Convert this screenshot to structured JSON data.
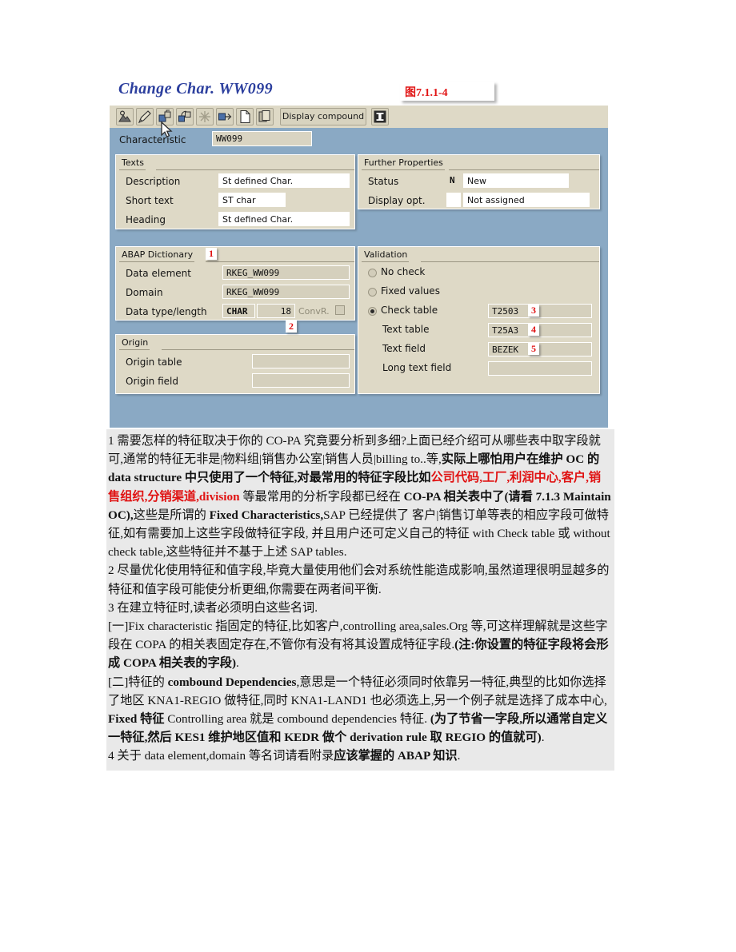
{
  "screenshot": {
    "window_title": "Change Char. WW099",
    "figure_label": "图7.1.1-4",
    "toolbar": {
      "icons": [
        {
          "name": "display-overview-icon",
          "glyph": "person-mountain"
        },
        {
          "name": "edit-pencil-icon",
          "glyph": "pencil"
        },
        {
          "name": "create-characteristic-icon",
          "glyph": "boxes-up"
        },
        {
          "name": "copy-characteristic-icon",
          "glyph": "boxes-link"
        },
        {
          "name": "delete-star-icon",
          "glyph": "asterisk"
        },
        {
          "name": "transport-icon",
          "glyph": "box-arrow"
        },
        {
          "name": "new-document-icon",
          "glyph": "page"
        },
        {
          "name": "copy-document-icon",
          "glyph": "pages"
        }
      ],
      "display_compound_label": "Display compound",
      "info_label": "i"
    },
    "characteristic": {
      "label": "Characteristic",
      "value": "WW099"
    },
    "texts_group": {
      "title": "Texts",
      "rows": [
        {
          "label": "Description",
          "value": "St defined Char."
        },
        {
          "label": "Short text",
          "value": "ST char"
        },
        {
          "label": "Heading",
          "value": "St defined Char."
        }
      ]
    },
    "further_properties_group": {
      "title": "Further Properties",
      "status": {
        "label": "Status",
        "code": "N",
        "value": "New"
      },
      "display_opt": {
        "label": "Display opt.",
        "code": "",
        "value": "Not assigned"
      }
    },
    "abap_dictionary_group": {
      "title": "ABAP Dictionary",
      "badge": "1",
      "rows": [
        {
          "label": "Data element",
          "value": "RKEG_WW099"
        },
        {
          "label": "Domain",
          "value": "RKEG_WW099"
        }
      ],
      "data_type": {
        "label": "Data type/length",
        "type": "CHAR",
        "length": "18",
        "conv_label": "ConvR.",
        "badge": "2"
      }
    },
    "origin_group": {
      "title": "Origin",
      "rows": [
        {
          "label": "Origin table",
          "value": ""
        },
        {
          "label": "Origin field",
          "value": ""
        }
      ]
    },
    "validation_group": {
      "title": "Validation",
      "options": [
        {
          "label": "No check",
          "selected": false
        },
        {
          "label": "Fixed values",
          "selected": false
        },
        {
          "label": "Check table",
          "selected": true
        }
      ],
      "check_table": {
        "value": "T2503",
        "badge": "3"
      },
      "text_table": {
        "label": "Text table",
        "value": "T25A3",
        "badge": "4"
      },
      "text_field": {
        "label": "Text field",
        "value": "BEZEK",
        "badge": "5"
      },
      "long_text_field": {
        "label": "Long text field",
        "value": ""
      }
    }
  },
  "document": {
    "paragraphs": [
      {
        "id": "p1",
        "runs": [
          {
            "t": "1 需要怎样的特征取决于你的 CO-PA 究竟要分析到多细?上面已经介绍可从哪些表中取字段就可,通常的特征无非是|物料组|销售办公室|销售人员|billing to..等,",
            "style": "normal"
          },
          {
            "t": "实际上哪怕用户在维护 OC 的 data structure 中只使用了一个特征,对最常用的特征字段比如",
            "style": "bold"
          },
          {
            "t": "公司代码,工厂,利润中心,客户,销售组织,分销渠道,division",
            "style": "red"
          },
          {
            "t": " 等最常用的分析字段都已经在 ",
            "style": "normal"
          },
          {
            "t": "CO-PA 相关表中了(请看 7.1.3 Maintain OC),",
            "style": "bold"
          },
          {
            "t": "这些是所谓的 ",
            "style": "normal"
          },
          {
            "t": "Fixed Characteristics,",
            "style": "bold"
          },
          {
            "t": "SAP 已经提供了 客户|销售订单等表的相应字段可做特征,如有需要加上这些字段做特征字段, 并且用户还可定义自己的特征 with Check table 或 without check table,这些特征并不基于上述 SAP tables.",
            "style": "normal"
          }
        ]
      },
      {
        "id": "p2",
        "runs": [
          {
            "t": "2 尽量优化使用特征和值字段,毕竟大量使用他们会对系统性能造成影响,虽然道理很明显越多的特征和值字段可能使分析更细,你需要在两者间平衡.",
            "style": "normal"
          }
        ]
      },
      {
        "id": "p3",
        "runs": [
          {
            "t": "3 在建立特征时,读者必须明白这些名词.",
            "style": "normal"
          }
        ]
      },
      {
        "id": "p4",
        "runs": [
          {
            "t": "[一]Fix characteristic 指固定的特征,比如客户,controlling area,sales.Org 等,可这样理解就是这些字段在 COPA 的相关表固定存在,不管你有没有将其设置成特征字段.",
            "style": "normal"
          },
          {
            "t": "(注:你设置的特征字段将会形成 COPA 相关表的字段)",
            "style": "bold"
          },
          {
            "t": ".",
            "style": "normal"
          }
        ]
      },
      {
        "id": "p5",
        "runs": [
          {
            "t": "[二]特征的 ",
            "style": "normal"
          },
          {
            "t": "combound Dependencies",
            "style": "bold"
          },
          {
            "t": ",意思是一个特征必须同时依靠另一特征,典型的比如你选择了地区 KNA1-REGIO 做特征,同时 KNA1-LAND1 也必须选上,另一个例子就是选择了成本中心, ",
            "style": "normal"
          },
          {
            "t": "Fixed 特征",
            "style": "bold"
          },
          {
            "t": " Controlling area 就是 combound dependencies 特征. ",
            "style": "normal"
          },
          {
            "t": "(为了节省一字段,所以通常自定义一特征,然后 KES1 维护地区值和 KEDR 做个 derivation rule 取 REGIO 的值就可)",
            "style": "bold"
          },
          {
            "t": ".",
            "style": "normal"
          }
        ]
      },
      {
        "id": "p6",
        "runs": [
          {
            "t": "4 关于 data element,domain 等名词请看附录",
            "style": "normal"
          },
          {
            "t": "应该掌握的 ABAP 知识",
            "style": "bold"
          },
          {
            "t": ".",
            "style": "normal"
          }
        ]
      }
    ]
  },
  "colors": {
    "title_blue": "#2c3f9e",
    "annotation_red": "#e01212",
    "panel_bg": "#8aa9c4",
    "group_bg": "#ded9c6",
    "field_bg": "#d5d0bd",
    "doc_bg": "#e9e9e9"
  }
}
